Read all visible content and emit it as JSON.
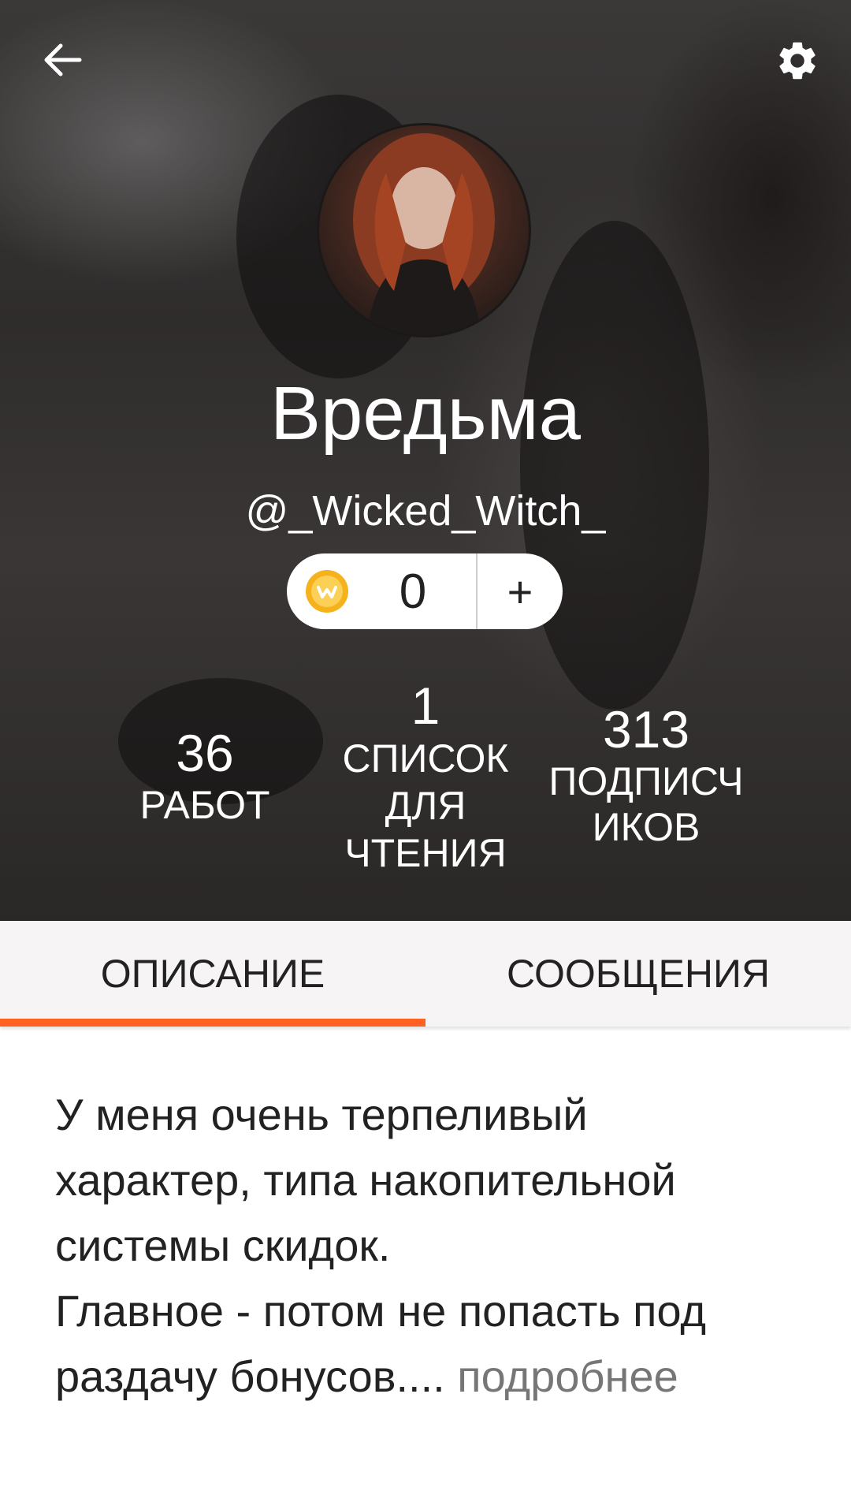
{
  "profile": {
    "display_name": "Вредьма",
    "username": "@_Wicked_Witch_",
    "coins": "0",
    "add_coins_label": "+"
  },
  "stats": {
    "works": {
      "value": "36",
      "label": "РАБОТ"
    },
    "reading_lists": {
      "value": "1",
      "label_line1": "СПИСОК",
      "label_line2": "ДЛЯ",
      "label_line3": "ЧТЕНИЯ"
    },
    "followers": {
      "value": "313",
      "label_line1": "ПОДПИСЧ",
      "label_line2": "ИКОВ"
    }
  },
  "tabs": [
    {
      "label": "ОПИСАНИЕ",
      "active": true
    },
    {
      "label": "СООБЩЕНИЯ",
      "active": false
    }
  ],
  "description": {
    "line1": "У меня очень терпеливый",
    "line2": "характер, типа накопительной",
    "line3": "системы скидок.",
    "line4": "Главное - потом не попасть под",
    "line5": "раздачу бонусов.",
    "ellipsis": "... ",
    "more_label": "подробнее"
  },
  "colors": {
    "accent": "#ff6122",
    "coin": "#f5b21b"
  },
  "icons": {
    "back": "arrow-left-icon",
    "settings": "gear-icon",
    "coin": "coin-icon"
  }
}
